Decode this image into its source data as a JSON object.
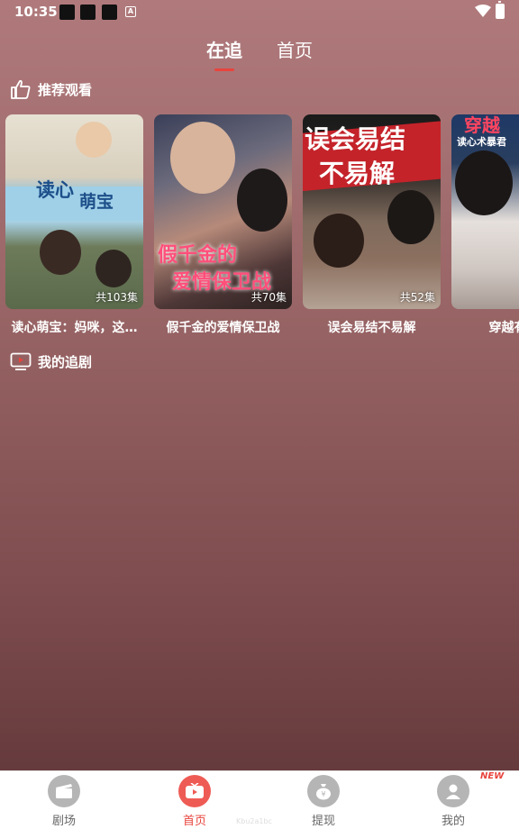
{
  "status_bar": {
    "time": "10:35",
    "notif_a_letter": "A"
  },
  "top_tabs": {
    "following": "在追",
    "home": "首页"
  },
  "sections": {
    "recommended": "推荐观看",
    "my_dramas": "我的追剧"
  },
  "cards": [
    {
      "title": "读心萌宝：妈咪，这…",
      "episodes": "共103集",
      "poster_text_1": "读心",
      "poster_text_2": "萌宝"
    },
    {
      "title": "假千金的爱情保卫战",
      "episodes": "共70集",
      "poster_text_1": "假千金的",
      "poster_text_2": "爱情保卫战"
    },
    {
      "title": "误会易结不易解",
      "episodes": "共52集",
      "poster_text_1": "误会易结",
      "poster_text_2": "不易解"
    },
    {
      "title": "穿越有方：",
      "episodes": "",
      "poster_text_1": "穿越",
      "poster_text_2": "读心术暴君"
    }
  ],
  "bottom_nav": {
    "theater": "剧场",
    "home": "首页",
    "withdraw": "提现",
    "mine": "我的",
    "new_badge": "NEW",
    "accent": "#e8443d"
  },
  "watermark": "Kbu2a1bc"
}
